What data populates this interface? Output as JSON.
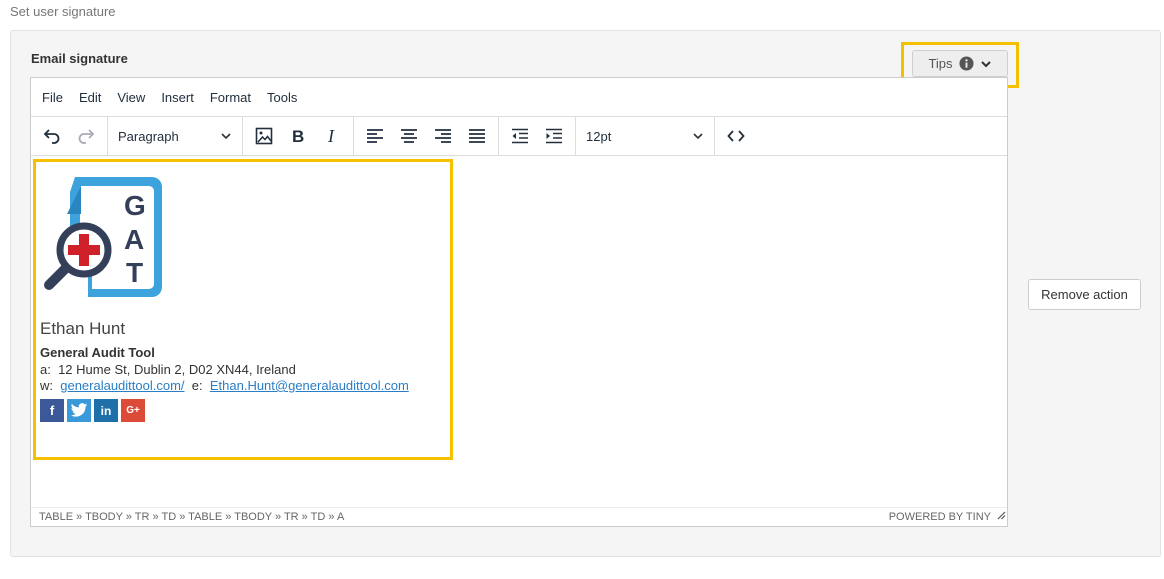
{
  "page": {
    "label": "Set user signature"
  },
  "panel": {
    "title": "Email signature"
  },
  "tips": {
    "label": "Tips",
    "icon": "info-icon"
  },
  "remove_action": {
    "label": "Remove action"
  },
  "editor": {
    "menu": [
      "File",
      "Edit",
      "View",
      "Insert",
      "Format",
      "Tools"
    ],
    "block_format": "Paragraph",
    "font_size": "12pt",
    "statusbar": {
      "path": "TABLE » TBODY » TR » TD » TABLE » TBODY » TR » TD » A",
      "powered": "POWERED BY TINY"
    }
  },
  "signature": {
    "name": "Ethan Hunt",
    "company": "General Audit Tool",
    "address_label": "a:",
    "address": "12 Hume St, Dublin 2, D02 XN44, Ireland",
    "web_label": "w:",
    "web": "generalaudittool.com/",
    "email_label": "e:",
    "email": "Ethan.Hunt@generalaudittool.com",
    "logo_letters": [
      "G",
      "A",
      "T"
    ],
    "socials": [
      {
        "name": "facebook",
        "glyph": "f",
        "color": "#3b5998"
      },
      {
        "name": "twitter",
        "glyph": "t",
        "color": "#3a9ad9"
      },
      {
        "name": "linkedin",
        "glyph": "in",
        "color": "#1f6fa8"
      },
      {
        "name": "google-plus",
        "glyph": "G+",
        "color": "#dc4a38"
      }
    ]
  },
  "colors": {
    "highlight": "#f5c000",
    "link": "#2a7ec5",
    "logo_blue": "#3ea3dd",
    "logo_dark": "#34405a",
    "logo_red": "#d0202a"
  }
}
